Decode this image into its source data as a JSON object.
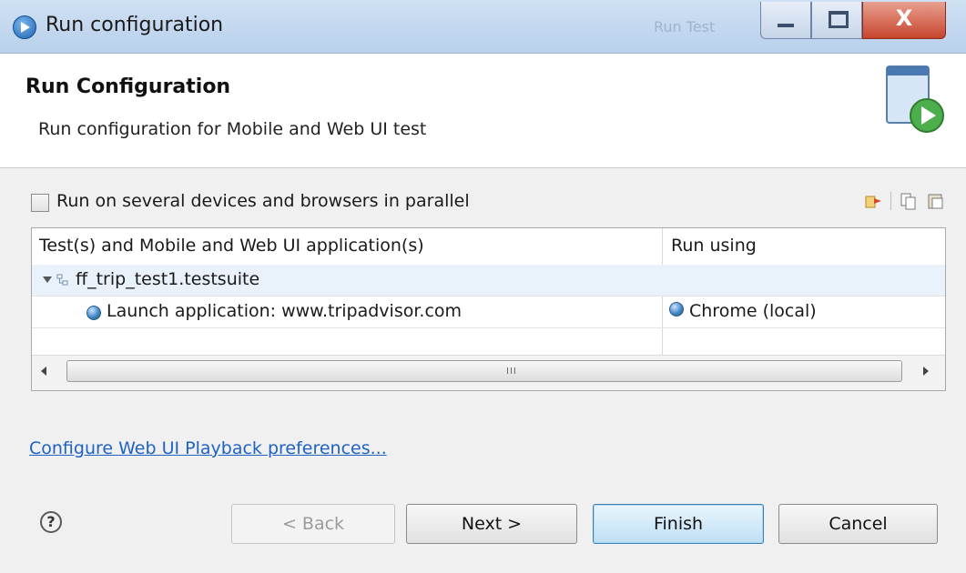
{
  "window": {
    "title": "Run configuration",
    "ghost_title": "Run Test",
    "close_glyph": "X",
    "icons": {
      "app": "run-globe-icon",
      "minimize": "minimize-icon",
      "maximize": "maximize-icon",
      "close": "close-icon"
    }
  },
  "header": {
    "title": "Run Configuration",
    "description": "Run configuration for Mobile and Web UI test",
    "graphic_icon": "run-wizard-banner-icon"
  },
  "parallel": {
    "label": "Run on several devices and browsers in parallel",
    "checked": false
  },
  "toolbar": {
    "icons": [
      "add-device-icon",
      "copy-icon",
      "paste-icon"
    ]
  },
  "table": {
    "columns": [
      "Test(s) and Mobile and Web UI application(s)",
      "Run using"
    ],
    "rows": [
      {
        "name": "ff_trip_test1.testsuite",
        "run_using": "",
        "expanded": true,
        "icon": "testsuite-icon"
      },
      {
        "name": "Launch application: www.tripadvisor.com",
        "run_using": "Chrome (local)",
        "icon": "globe-icon"
      }
    ],
    "scroll_grip": "III"
  },
  "preferences_link": "Configure Web UI Playback preferences...",
  "help_glyph": "?",
  "buttons": {
    "back": "< Back",
    "next": "Next >",
    "finish": "Finish",
    "cancel": "Cancel"
  },
  "colors": {
    "titlebar": "#b9d1ec",
    "link": "#1d62c4",
    "close_button": "#c7452d",
    "selected_row": "#e9f1fb"
  }
}
